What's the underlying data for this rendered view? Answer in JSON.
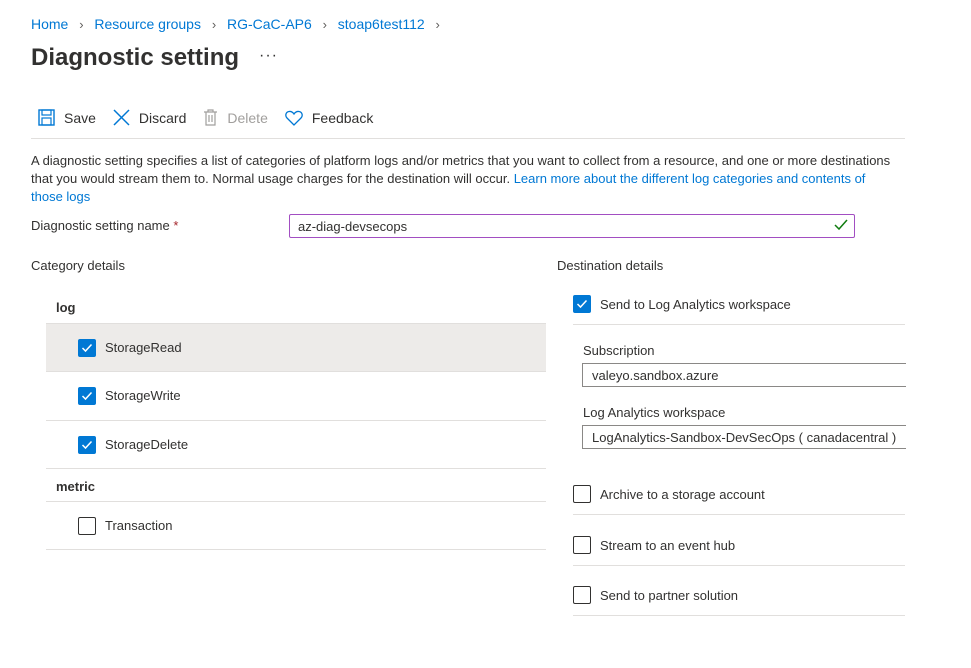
{
  "breadcrumb": [
    "Home",
    "Resource groups",
    "RG-CaC-AP6",
    "stoap6test112"
  ],
  "page": {
    "title": "Diagnostic setting",
    "more": "···"
  },
  "toolbar": {
    "save": "Save",
    "discard": "Discard",
    "delete": "Delete",
    "feedback": "Feedback"
  },
  "description": {
    "text": "A diagnostic setting specifies a list of categories of platform logs and/or metrics that you want to collect from a resource, and one or more destinations that you would stream them to. Normal usage charges for the destination will occur. ",
    "link": "Learn more about the different log categories and contents of those logs"
  },
  "name_field": {
    "label": "Diagnostic setting name",
    "required": "*",
    "value": "az-diag-devsecops"
  },
  "category": {
    "title": "Category details",
    "log_header": "log",
    "logs": [
      {
        "label": "StorageRead",
        "checked": true
      },
      {
        "label": "StorageWrite",
        "checked": true
      },
      {
        "label": "StorageDelete",
        "checked": true
      }
    ],
    "metric_header": "metric",
    "metrics": [
      {
        "label": "Transaction",
        "checked": false
      }
    ]
  },
  "destination": {
    "title": "Destination details",
    "log_analytics": {
      "label": "Send to Log Analytics workspace",
      "checked": true
    },
    "subscription_label": "Subscription",
    "subscription_value": "valeyo.sandbox.azure",
    "workspace_label": "Log Analytics workspace",
    "workspace_value": "LogAnalytics-Sandbox-DevSecOps ( canadacentral )",
    "storage": {
      "label": "Archive to a storage account",
      "checked": false
    },
    "event_hub": {
      "label": "Stream to an event hub",
      "checked": false
    },
    "partner": {
      "label": "Send to partner solution",
      "checked": false
    }
  },
  "colors": {
    "link": "#0078d4",
    "checkbox": "#0078d4",
    "input_border": "#a24ec2",
    "valid_check": "#107c10"
  }
}
